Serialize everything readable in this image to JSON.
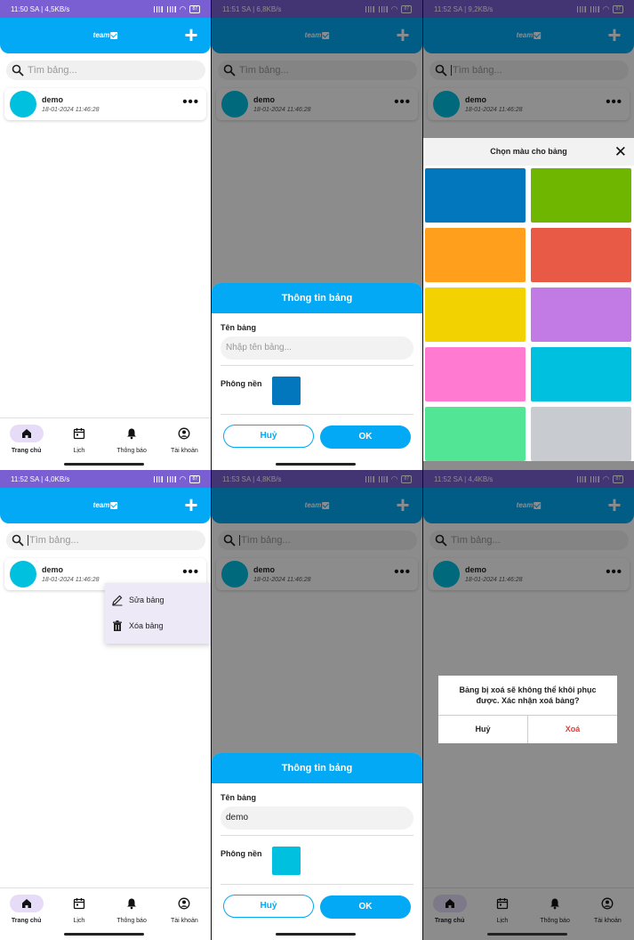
{
  "app": {
    "logo_text": "team",
    "search_placeholder": "Tìm bảng...",
    "board": {
      "name": "demo",
      "date": "18-01-2024 11:46:28"
    }
  },
  "screens": [
    {
      "status": "11:50 SA | 4,5KB/s",
      "battery": "87"
    },
    {
      "status": "11:51 SA | 6,8KB/s",
      "battery": "87"
    },
    {
      "status": "11:52 SA | 9,2KB/s",
      "battery": "87"
    },
    {
      "status": "11:52 SA | 4,0KB/s",
      "battery": "87"
    },
    {
      "status": "11:53 SA | 4,8KB/s",
      "battery": "87"
    },
    {
      "status": "11:52 SA | 4,4KB/s",
      "battery": "87"
    }
  ],
  "nav": {
    "home": "Trang chủ",
    "calendar": "Lịch",
    "notifications": "Thông báo",
    "account": "Tài khoản"
  },
  "sheet": {
    "title": "Thông tin bảng",
    "name_label": "Tên bảng",
    "name_placeholder": "Nhập tên bảng...",
    "name_value": "demo",
    "bg_label": "Phông nền",
    "cancel": "Huỷ",
    "ok": "OK"
  },
  "picker": {
    "title": "Chọn màu cho bảng",
    "colors": [
      "#0277bd",
      "#6fb600",
      "#ff9f1c",
      "#e85a45",
      "#f2d200",
      "#c27ae5",
      "#ff7ad0",
      "#00c0e0",
      "#52e595",
      "#c8ccd0"
    ]
  },
  "context_menu": {
    "edit": "Sửa bảng",
    "delete": "Xóa bảng"
  },
  "dialog": {
    "message": "Bảng bị xoá sẽ không thể khôi phục được. Xác nhận xoá bảng?",
    "cancel": "Huỷ",
    "delete": "Xoá"
  },
  "colors": {
    "primary": "#03a9f4",
    "status_bar": "#7a5fd3",
    "swatch_blue": "#0277bd",
    "swatch_cyan": "#00c0e0",
    "danger": "#e53935"
  }
}
